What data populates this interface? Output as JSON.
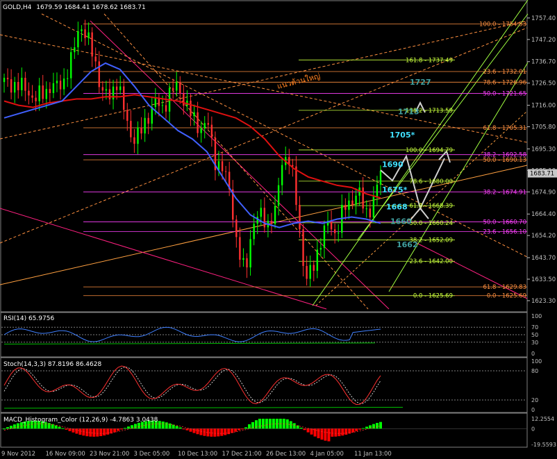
{
  "header": {
    "symbol": "GOLD,H4",
    "ohlc": "1679.59 1684.41 1678.62 1683.71"
  },
  "colors": {
    "background": "#000000",
    "panel_border": "#808080",
    "candle_up": "#00ff00",
    "candle_down": "#ff3030",
    "ma_red": "#e01010",
    "ma_blue": "#4060ff",
    "fib_green": "#c8ff3c",
    "fib_orange": "#ff9040",
    "fib_magenta": "#ff40ff",
    "line_orange": "#ffa040",
    "line_pink": "#ff2080",
    "channel_green": "#a0ff40",
    "label_cyan": "#40e0ff",
    "label_teal": "#40a0a0",
    "label_gray": "#c0c0c0",
    "thai_text": "#ff8020",
    "rsi_line": "#4080ff",
    "stoch_line": "#ff3030",
    "histogram_up": "#00ff00",
    "histogram_down": "#ff0000"
  },
  "price_axis": {
    "ticks": [
      "1757.40",
      "1747.20",
      "1736.70",
      "1726.50",
      "1716.00",
      "1705.80",
      "1695.30",
      "1685.10",
      "1674.90",
      "1664.40",
      "1654.20",
      "1643.70",
      "1633.50",
      "1623.30"
    ],
    "current": "1683.71"
  },
  "time_axis": {
    "labels": [
      "9 Nov 2012",
      "16 Nov 09:00",
      "23 Nov 21:00",
      "3 Dec 05:00",
      "10 Dec 13:00",
      "17 Dec 21:00",
      "26 Dec 13:00",
      "4 Jan 05:00",
      "11 Jan 13:00"
    ]
  },
  "fib_right": [
    {
      "text": "100.0 - 1754.53",
      "color": "#ff9040"
    },
    {
      "text": "23.6 - 1732.01",
      "color": "#ff9040"
    },
    {
      "text": "78.6 - 1726.96",
      "color": "#ff9040"
    },
    {
      "text": "50.0 - 1721.65",
      "color": "#ff40ff"
    },
    {
      "text": "61.8 - 1705.31",
      "color": "#ff9040"
    },
    {
      "text": "38.2 - 1692.58",
      "color": "#ff40ff"
    },
    {
      "text": "50.0 - 1690.13",
      "color": "#ff9040"
    },
    {
      "text": "38.2 - 1674.91",
      "color": "#ff40ff"
    },
    {
      "text": "50.0 - 1660.70",
      "color": "#ff40ff"
    },
    {
      "text": "23.6 - 1656.10",
      "color": "#ff40ff"
    },
    {
      "text": "61.8 - 1629.83",
      "color": "#ff9040"
    },
    {
      "text": "0.0 - 1625.69",
      "color": "#ff9040"
    }
  ],
  "fib_mid": [
    "161.8 - 1737.49",
    "138.2 - 1713.59",
    "100.0 - 1694.79",
    "78.6 - 1680.00",
    "61.8 - 1668.39",
    "50.0 - 1660.24",
    "38.2 - 1652.09",
    "23.6 - 1642.00",
    "0.0 - 1625.69"
  ],
  "annotations": [
    {
      "text": "1727",
      "color": "#40a0a0"
    },
    {
      "text": "1713",
      "color": "#40a0a0"
    },
    {
      "text": "1705*",
      "color": "#40e0ff"
    },
    {
      "text": "1690",
      "color": "#40e0ff"
    },
    {
      "text": "1675*",
      "color": "#40e0ff"
    },
    {
      "text": "1668",
      "color": "#40e0ff"
    },
    {
      "text": "1660",
      "color": "#40a0a0"
    },
    {
      "text": "1662",
      "color": "#40a0a0"
    }
  ],
  "thai_label": "แนวต้านใหญ่",
  "rsi": {
    "label": "RSI(14) 65.9756",
    "ticks": [
      "100",
      "70",
      "50",
      "30",
      "0"
    ]
  },
  "stoch": {
    "label": "Stoch(14,3,3) 87.8196 86.4628",
    "ticks": [
      "100",
      "80",
      "20",
      "0"
    ]
  },
  "macd": {
    "label": "MACD_Histogram_Color (12,26,9) -4.7863 3.0438",
    "ticks": [
      "12.2554",
      "0",
      "-19.5593"
    ]
  },
  "chart_data": {
    "type": "candlestick",
    "title": "GOLD,H4",
    "ylim": [
      1620,
      1760
    ],
    "x": [
      "9 Nov 2012",
      "16 Nov 09:00",
      "23 Nov 21:00",
      "3 Dec 05:00",
      "10 Dec 13:00",
      "17 Dec 21:00",
      "26 Dec 13:00",
      "4 Jan 05:00",
      "11 Jan 13:00"
    ],
    "close_path": [
      1727,
      1726,
      1725,
      1724,
      1718,
      1722,
      1724,
      1725,
      1728,
      1738,
      1755,
      1748,
      1738,
      1722,
      1720,
      1728,
      1712,
      1700,
      1702,
      1710,
      1718,
      1714,
      1722,
      1725,
      1718,
      1710,
      1705,
      1708,
      1690,
      1686,
      1675,
      1648,
      1636,
      1660,
      1664,
      1660,
      1665,
      1692,
      1690,
      1665,
      1633,
      1638,
      1652,
      1660,
      1655,
      1666,
      1670,
      1676,
      1664,
      1670,
      1684
    ],
    "ma_red_path": [
      1718,
      1716,
      1715,
      1717,
      1718,
      1719,
      1719,
      1720,
      1720,
      1721,
      1720,
      1719,
      1718,
      1716,
      1714,
      1712,
      1710,
      1706,
      1700,
      1692,
      1686,
      1682,
      1680,
      1678,
      1677,
      1674,
      1672
    ],
    "ma_blue_path": [
      1710,
      1712,
      1714,
      1716,
      1718,
      1725,
      1732,
      1736,
      1733,
      1725,
      1716,
      1710,
      1704,
      1700,
      1694,
      1683,
      1672,
      1664,
      1660,
      1658,
      1660,
      1661,
      1660,
      1662,
      1663,
      1662,
      1660
    ],
    "rsi_value": 65.9756,
    "rsi_levels": [
      70,
      50,
      30
    ],
    "stoch_values": [
      87.8196,
      86.4628
    ],
    "stoch_levels": [
      80,
      20
    ],
    "macd_values": [
      -4.7863,
      3.0438
    ],
    "macd_range": [
      -19.5593,
      12.2554
    ]
  }
}
